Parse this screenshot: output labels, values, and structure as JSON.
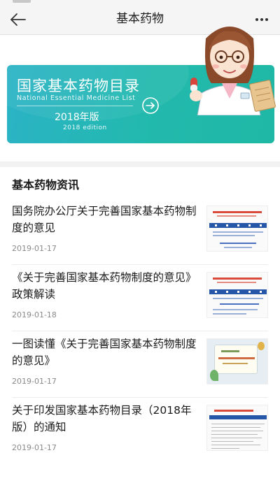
{
  "header": {
    "title": "基本药物",
    "back_icon": "back-arrow-icon",
    "more_icon": "more-dots-icon"
  },
  "banner": {
    "title": "国家基本药物目录",
    "subtitle": "National Essential Medicine List",
    "edition": "2018年版",
    "edition_en": "2018 edition",
    "arrow_icon": "arrow-right-circle-icon",
    "colors": {
      "start": "#2bb3c6",
      "end": "#1fb8a5"
    }
  },
  "section": {
    "title": "基本药物资讯"
  },
  "news": [
    {
      "title": "国务院办公厅关于完善国家基本药物制度的意见",
      "date": "2019-01-17",
      "thumb": "document-thumbnail"
    },
    {
      "title": "《关于完善国家基本药物制度的意见》政策解读",
      "date": "2019-01-18",
      "thumb": "document-thumbnail"
    },
    {
      "title": "一图读懂《关于完善国家基本药物制度的意见》",
      "date": "2019-01-17",
      "thumb": "infographic-thumbnail"
    },
    {
      "title": "关于印发国家基本药物目录（2018年版）的通知",
      "date": "2019-01-17",
      "thumb": "notice-page-thumbnail"
    }
  ]
}
